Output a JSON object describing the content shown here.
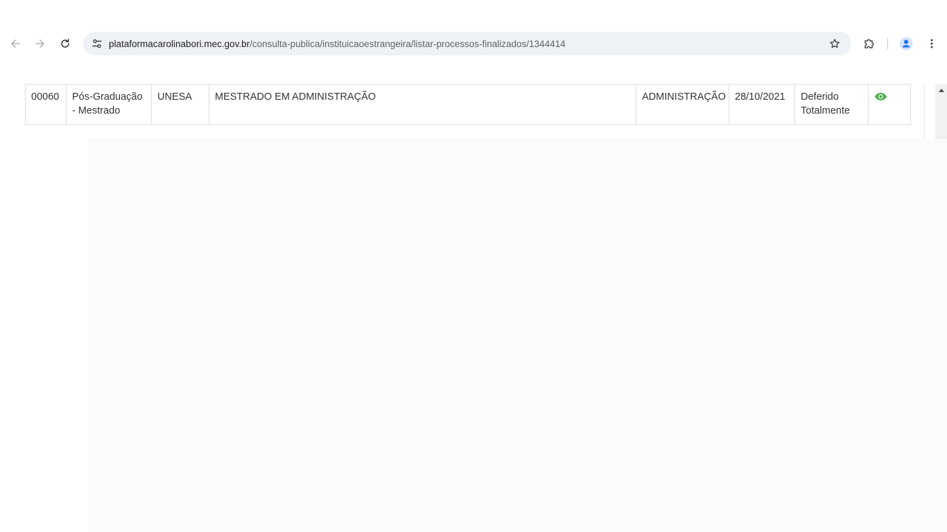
{
  "browser": {
    "url_host": "plataformacarolinabori.mec.gov.br",
    "url_path": "/consulta-publica/instituicaoestrangeira/listar-processos-finalizados/1344414",
    "icons": {
      "back": "arrow-left-icon",
      "forward": "arrow-right-icon",
      "reload": "reload-icon",
      "site_info": "tune-icon",
      "bookmark": "star-icon",
      "extensions": "puzzle-icon",
      "profile": "person-icon",
      "menu": "kebab-menu-icon"
    },
    "colors": {
      "omnibox_bg": "#eef1f5",
      "profile_blue": "#1a73e8"
    }
  },
  "table": {
    "rows": [
      {
        "numero": "00060",
        "tipo": "Pós-Graduação - Mestrado",
        "instituicao": "UNESA",
        "curso": "MESTRADO EM ADMINISTRAÇÃO",
        "area": "ADMINISTRAÇÃO",
        "data": "28/10/2021",
        "situacao": "Deferido Totalmente",
        "acao_icon": "eye-icon"
      }
    ],
    "colors": {
      "eye_green": "#4cae4c",
      "border": "#dddddd"
    }
  }
}
